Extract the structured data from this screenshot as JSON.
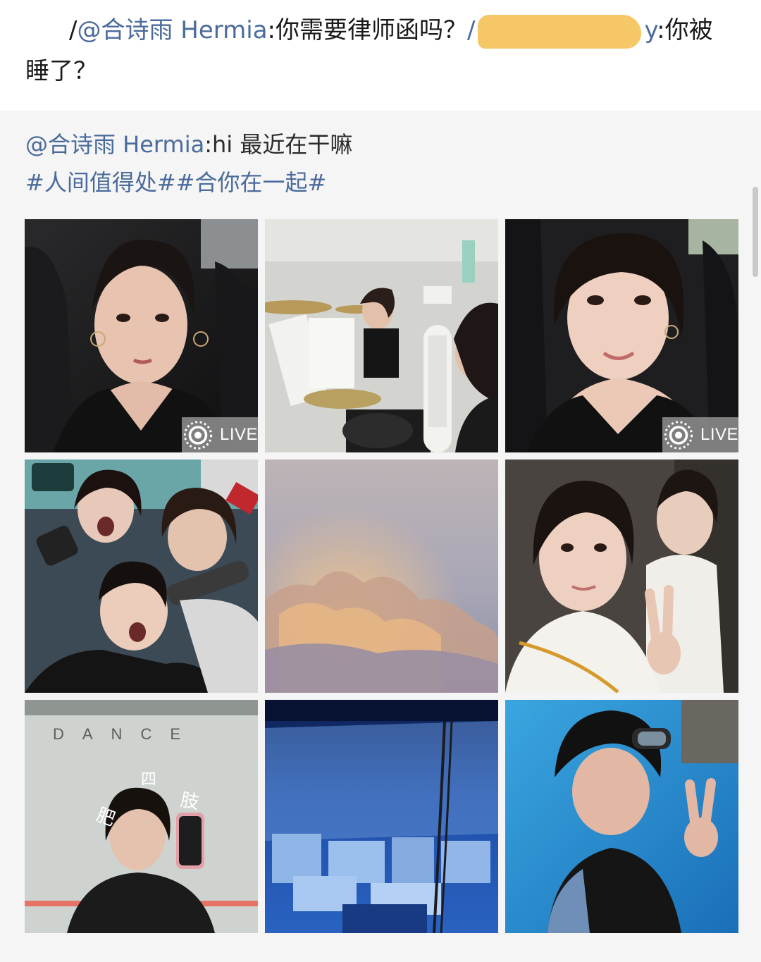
{
  "comment": {
    "lead_mark": "/",
    "mention_1": "@合诗雨 Hermia",
    "text_1": ":你需要律师函吗？",
    "separator": "/",
    "redacted_tail": "y",
    "text_2": ":你被睡了？"
  },
  "quote": {
    "mention": "@合诗雨 Hermia",
    "text": ":hi 最近在干嘛",
    "topics": "#人间值得处##合你在一起#"
  },
  "photos": [
    {
      "subject": "selfie-car",
      "badge": "LIVE"
    },
    {
      "subject": "drum-practice"
    },
    {
      "subject": "selfie-car-smile",
      "badge": "LIVE"
    },
    {
      "subject": "group-karaoke"
    },
    {
      "subject": "sunset-clouds"
    },
    {
      "subject": "selfie-friend-peace"
    },
    {
      "subject": "mirror-selfie-dance",
      "photo_text": "DANCE",
      "handwriting": [
        "肥",
        "四",
        "肢"
      ]
    },
    {
      "subject": "stage-blue"
    },
    {
      "subject": "swimming-pool-peace"
    }
  ],
  "colors": {
    "link": "#4a6b9b",
    "quote_bg": "#f5f5f5",
    "redaction": "#f6c766"
  }
}
